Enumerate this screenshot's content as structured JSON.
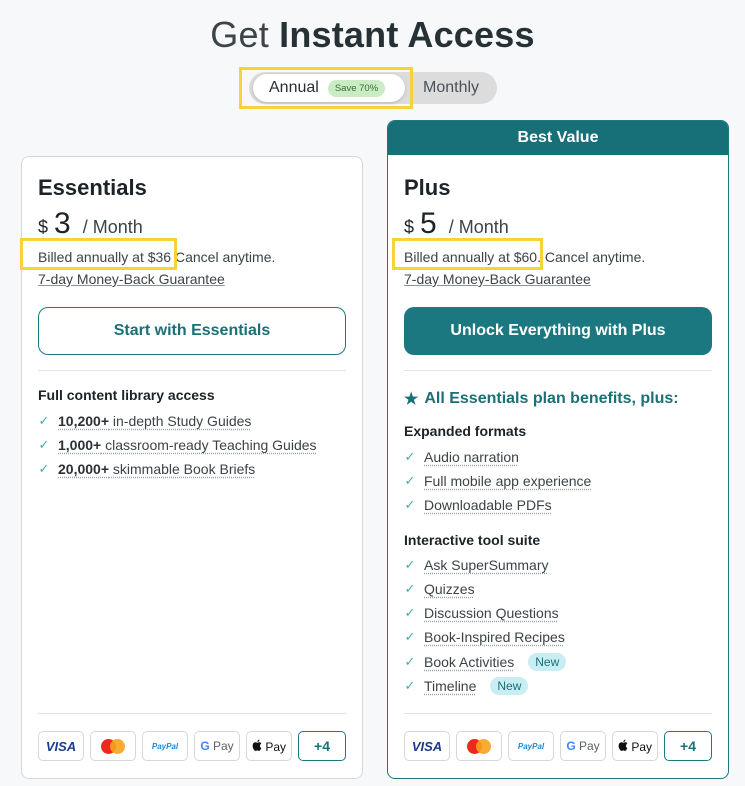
{
  "header": {
    "title_prefix": "Get",
    "title_bold": "Instant Access"
  },
  "billing_toggle": {
    "annual_label": "Annual",
    "save_badge": "Save 70%",
    "monthly_label": "Monthly",
    "selected": "Annual"
  },
  "plans": {
    "essentials": {
      "name": "Essentials",
      "currency": "$",
      "amount": "3",
      "period": "/ Month",
      "billed": "Billed annually at $36",
      "cancel": " Cancel anytime.",
      "guarantee": "7-day Money-Back Guarantee",
      "cta": "Start with Essentials",
      "section_title": "Full content library access",
      "features": [
        {
          "bold": "10,200+",
          "text": " in-depth Study Guides"
        },
        {
          "bold": "1,000+",
          "text": " classroom-ready Teaching Guides"
        },
        {
          "bold": "20,000+",
          "text": " skimmable Book Briefs"
        }
      ]
    },
    "plus": {
      "banner": "Best Value",
      "name": "Plus",
      "currency": "$",
      "amount": "5",
      "period": "/ Month",
      "billed": "Billed annually at $60.",
      "cancel": " Cancel anytime.",
      "guarantee": "7-day Money-Back Guarantee",
      "cta": "Unlock Everything with Plus",
      "benefits_heading": "All Essentials plan benefits, plus:",
      "expanded_title": "Expanded formats",
      "expanded": [
        "Audio narration",
        "Full mobile app experience",
        "Downloadable PDFs"
      ],
      "interactive_title": "Interactive tool suite",
      "interactive": [
        {
          "text": "Ask SuperSummary",
          "badge": ""
        },
        {
          "text": "Quizzes",
          "badge": ""
        },
        {
          "text": "Discussion Questions",
          "badge": ""
        },
        {
          "text": "Book-Inspired Recipes",
          "badge": ""
        },
        {
          "text": "Book Activities",
          "badge": "New"
        },
        {
          "text": "Timeline",
          "badge": "New"
        }
      ]
    }
  },
  "payment": {
    "visa": "VISA",
    "paypal_a": "Pay",
    "paypal_b": "Pal",
    "gpay_g": "G",
    "gpay": " Pay",
    "apay": " Pay",
    "more": "+4"
  },
  "icons": {
    "check": "check-icon",
    "star": "star-icon",
    "mastercard": "mastercard-icon",
    "apple": "apple-icon"
  },
  "colors": {
    "accent": "#1c7880",
    "highlight": "#f7d238",
    "check": "#3fb0a6",
    "save_badge_bg": "#c9ecc4",
    "new_badge_bg": "#c8eef3"
  }
}
